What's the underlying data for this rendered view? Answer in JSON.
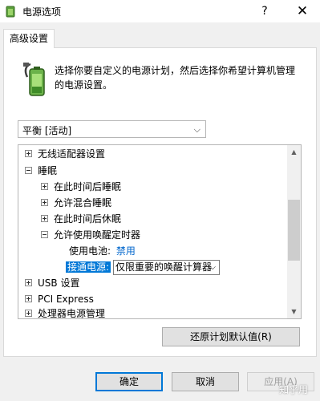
{
  "window": {
    "title": "电源选项",
    "help_label": "?",
    "close_label": "✕"
  },
  "tabs": [
    {
      "label": "高级设置"
    }
  ],
  "description": "选择你要自定义的电源计划，然后选择你希望计算机管理的电源设置。",
  "plan_select": {
    "value": "平衡 [活动]"
  },
  "tree": {
    "items": [
      {
        "label": "无线适配器设置"
      },
      {
        "label": "睡眠"
      },
      {
        "label": "在此时间后睡眠"
      },
      {
        "label": "允许混合睡眠"
      },
      {
        "label": "在此时间后休眠"
      },
      {
        "label": "允许使用唤醒定时器"
      },
      {
        "label": "使用电池:",
        "value": "禁用"
      },
      {
        "label": "接通电源:",
        "value": "仅限重要的唤醒计算器"
      },
      {
        "label": "USB 设置"
      },
      {
        "label": "PCI Express"
      },
      {
        "label": "处理器电源管理"
      }
    ]
  },
  "buttons": {
    "restore": "还原计划默认值(R)",
    "ok": "确定",
    "cancel": "取消",
    "apply": "应用(A)"
  },
  "watermark": "知乎用"
}
